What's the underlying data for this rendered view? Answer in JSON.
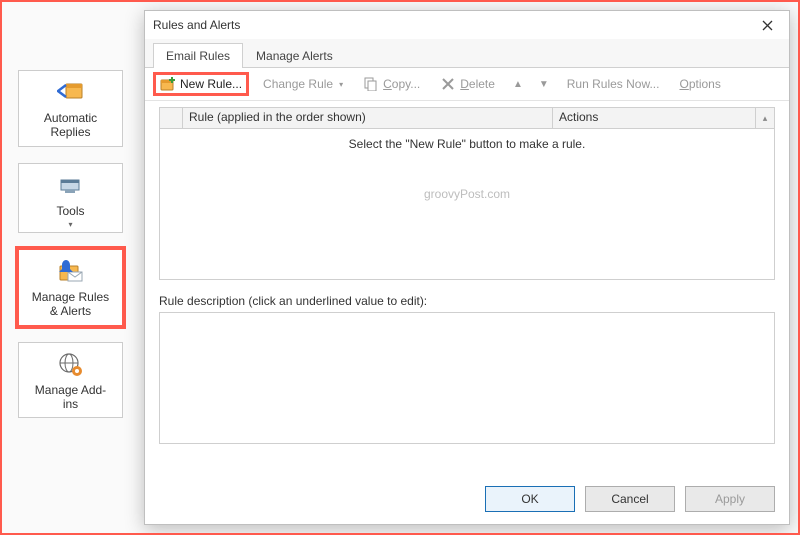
{
  "sidebar": {
    "items": [
      {
        "label": "Automatic\nReplies"
      },
      {
        "label": "Tools"
      },
      {
        "label": "Manage Rules\n& Alerts"
      },
      {
        "label": "Manage Add-\nins"
      }
    ]
  },
  "dialog": {
    "title": "Rules and Alerts",
    "tabs": [
      {
        "label": "Email Rules"
      },
      {
        "label": "Manage Alerts"
      }
    ],
    "toolbar": {
      "new_rule": "New Rule...",
      "change_rule": "Change Rule",
      "copy": "Copy...",
      "delete": "Delete",
      "run_rules": "Run Rules Now...",
      "options": "Options"
    },
    "grid": {
      "col_rule": "Rule (applied in the order shown)",
      "col_actions": "Actions",
      "empty_msg": "Select the \"New Rule\" button to make a rule."
    },
    "watermark": "groovyPost.com",
    "desc_label": "Rule description (click an underlined value to edit):",
    "buttons": {
      "ok": "OK",
      "cancel": "Cancel",
      "apply": "Apply"
    }
  }
}
